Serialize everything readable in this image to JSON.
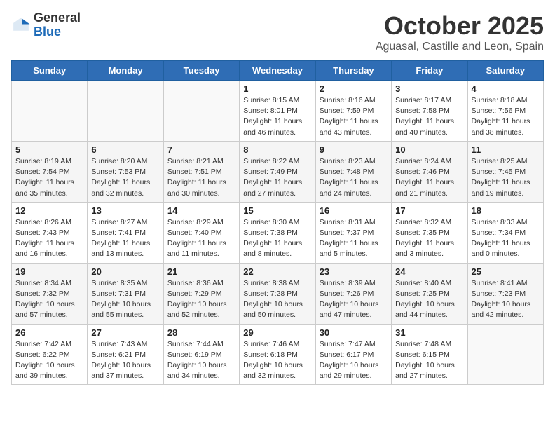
{
  "logo": {
    "general": "General",
    "blue": "Blue"
  },
  "title": "October 2025",
  "subtitle": "Aguasal, Castille and Leon, Spain",
  "days_of_week": [
    "Sunday",
    "Monday",
    "Tuesday",
    "Wednesday",
    "Thursday",
    "Friday",
    "Saturday"
  ],
  "weeks": [
    [
      {
        "day": "",
        "info": ""
      },
      {
        "day": "",
        "info": ""
      },
      {
        "day": "",
        "info": ""
      },
      {
        "day": "1",
        "info": "Sunrise: 8:15 AM\nSunset: 8:01 PM\nDaylight: 11 hours\nand 46 minutes."
      },
      {
        "day": "2",
        "info": "Sunrise: 8:16 AM\nSunset: 7:59 PM\nDaylight: 11 hours\nand 43 minutes."
      },
      {
        "day": "3",
        "info": "Sunrise: 8:17 AM\nSunset: 7:58 PM\nDaylight: 11 hours\nand 40 minutes."
      },
      {
        "day": "4",
        "info": "Sunrise: 8:18 AM\nSunset: 7:56 PM\nDaylight: 11 hours\nand 38 minutes."
      }
    ],
    [
      {
        "day": "5",
        "info": "Sunrise: 8:19 AM\nSunset: 7:54 PM\nDaylight: 11 hours\nand 35 minutes."
      },
      {
        "day": "6",
        "info": "Sunrise: 8:20 AM\nSunset: 7:53 PM\nDaylight: 11 hours\nand 32 minutes."
      },
      {
        "day": "7",
        "info": "Sunrise: 8:21 AM\nSunset: 7:51 PM\nDaylight: 11 hours\nand 30 minutes."
      },
      {
        "day": "8",
        "info": "Sunrise: 8:22 AM\nSunset: 7:49 PM\nDaylight: 11 hours\nand 27 minutes."
      },
      {
        "day": "9",
        "info": "Sunrise: 8:23 AM\nSunset: 7:48 PM\nDaylight: 11 hours\nand 24 minutes."
      },
      {
        "day": "10",
        "info": "Sunrise: 8:24 AM\nSunset: 7:46 PM\nDaylight: 11 hours\nand 21 minutes."
      },
      {
        "day": "11",
        "info": "Sunrise: 8:25 AM\nSunset: 7:45 PM\nDaylight: 11 hours\nand 19 minutes."
      }
    ],
    [
      {
        "day": "12",
        "info": "Sunrise: 8:26 AM\nSunset: 7:43 PM\nDaylight: 11 hours\nand 16 minutes."
      },
      {
        "day": "13",
        "info": "Sunrise: 8:27 AM\nSunset: 7:41 PM\nDaylight: 11 hours\nand 13 minutes."
      },
      {
        "day": "14",
        "info": "Sunrise: 8:29 AM\nSunset: 7:40 PM\nDaylight: 11 hours\nand 11 minutes."
      },
      {
        "day": "15",
        "info": "Sunrise: 8:30 AM\nSunset: 7:38 PM\nDaylight: 11 hours\nand 8 minutes."
      },
      {
        "day": "16",
        "info": "Sunrise: 8:31 AM\nSunset: 7:37 PM\nDaylight: 11 hours\nand 5 minutes."
      },
      {
        "day": "17",
        "info": "Sunrise: 8:32 AM\nSunset: 7:35 PM\nDaylight: 11 hours\nand 3 minutes."
      },
      {
        "day": "18",
        "info": "Sunrise: 8:33 AM\nSunset: 7:34 PM\nDaylight: 11 hours\nand 0 minutes."
      }
    ],
    [
      {
        "day": "19",
        "info": "Sunrise: 8:34 AM\nSunset: 7:32 PM\nDaylight: 10 hours\nand 57 minutes."
      },
      {
        "day": "20",
        "info": "Sunrise: 8:35 AM\nSunset: 7:31 PM\nDaylight: 10 hours\nand 55 minutes."
      },
      {
        "day": "21",
        "info": "Sunrise: 8:36 AM\nSunset: 7:29 PM\nDaylight: 10 hours\nand 52 minutes."
      },
      {
        "day": "22",
        "info": "Sunrise: 8:38 AM\nSunset: 7:28 PM\nDaylight: 10 hours\nand 50 minutes."
      },
      {
        "day": "23",
        "info": "Sunrise: 8:39 AM\nSunset: 7:26 PM\nDaylight: 10 hours\nand 47 minutes."
      },
      {
        "day": "24",
        "info": "Sunrise: 8:40 AM\nSunset: 7:25 PM\nDaylight: 10 hours\nand 44 minutes."
      },
      {
        "day": "25",
        "info": "Sunrise: 8:41 AM\nSunset: 7:23 PM\nDaylight: 10 hours\nand 42 minutes."
      }
    ],
    [
      {
        "day": "26",
        "info": "Sunrise: 7:42 AM\nSunset: 6:22 PM\nDaylight: 10 hours\nand 39 minutes."
      },
      {
        "day": "27",
        "info": "Sunrise: 7:43 AM\nSunset: 6:21 PM\nDaylight: 10 hours\nand 37 minutes."
      },
      {
        "day": "28",
        "info": "Sunrise: 7:44 AM\nSunset: 6:19 PM\nDaylight: 10 hours\nand 34 minutes."
      },
      {
        "day": "29",
        "info": "Sunrise: 7:46 AM\nSunset: 6:18 PM\nDaylight: 10 hours\nand 32 minutes."
      },
      {
        "day": "30",
        "info": "Sunrise: 7:47 AM\nSunset: 6:17 PM\nDaylight: 10 hours\nand 29 minutes."
      },
      {
        "day": "31",
        "info": "Sunrise: 7:48 AM\nSunset: 6:15 PM\nDaylight: 10 hours\nand 27 minutes."
      },
      {
        "day": "",
        "info": ""
      }
    ]
  ]
}
